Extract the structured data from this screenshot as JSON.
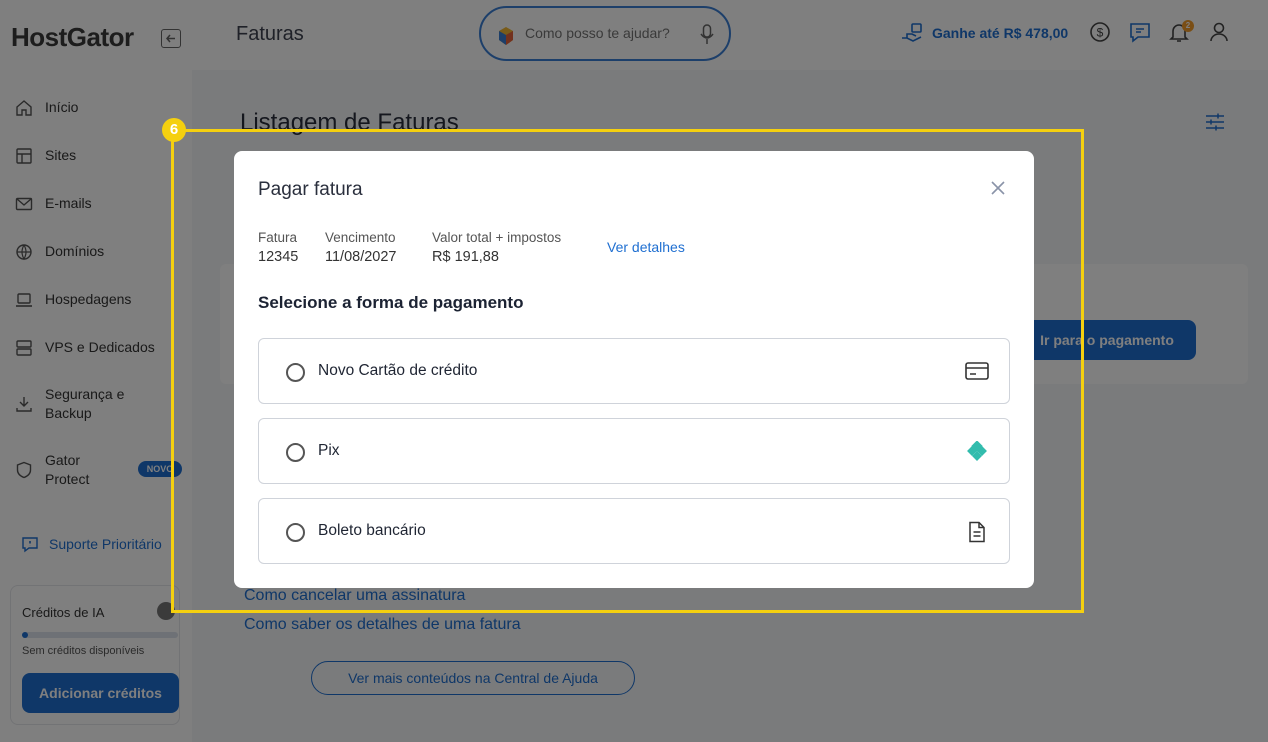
{
  "app": {
    "logo": "HostGator",
    "page_title": "Faturas"
  },
  "search": {
    "placeholder": "Como posso te ajudar?"
  },
  "header": {
    "promo_text": "Ganhe até R$ 478,00",
    "notification_count": "2"
  },
  "sidebar": {
    "items": [
      {
        "label": "Início",
        "icon": "home-icon"
      },
      {
        "label": "Sites",
        "icon": "layout-icon"
      },
      {
        "label": "E-mails",
        "icon": "mail-icon"
      },
      {
        "label": "Domínios",
        "icon": "globe-icon"
      },
      {
        "label": "Hospedagens",
        "icon": "laptop-icon"
      },
      {
        "label": "VPS e Dedicados",
        "icon": "server-icon"
      },
      {
        "label": "Segurança e Backup",
        "icon": "download-icon"
      },
      {
        "label": "Gator Protect",
        "icon": "shield-icon"
      }
    ],
    "nova_badge": "NOVO",
    "support_label": "Suporte Prioritário",
    "credits": {
      "title": "Créditos de IA",
      "progress": 0.03,
      "note": "Sem créditos disponíveis",
      "button_label": "Adicionar créditos"
    }
  },
  "main": {
    "title": "Listagem de Faturas",
    "pay_button": "Ir para o pagamento",
    "help_links": [
      "Como cancelar uma assinatura",
      "Como saber os detalhes de uma fatura"
    ],
    "help_more_button": "Ver mais conteúdos na Central de Ajuda"
  },
  "tutorial": {
    "step": "6",
    "highlight_color": "#f5d00f"
  },
  "modal": {
    "title": "Pagar fatura",
    "invoice_label": "Fatura",
    "invoice_value": "12345",
    "due_label": "Vencimento",
    "due_value": "11/08/2027",
    "total_label": "Valor total + impostos",
    "total_value": "R$ 191,88",
    "details_link": "Ver detalhes",
    "section_title": "Selecione a forma de pagamento",
    "options": [
      {
        "label": "Novo Cartão de crédito",
        "icon": "credit-card-icon"
      },
      {
        "label": "Pix",
        "icon": "pix-icon"
      },
      {
        "label": "Boleto bancário",
        "icon": "document-icon"
      }
    ]
  },
  "colors": {
    "brand_blue": "#1f6fd1",
    "pix_green": "#32bcad"
  }
}
